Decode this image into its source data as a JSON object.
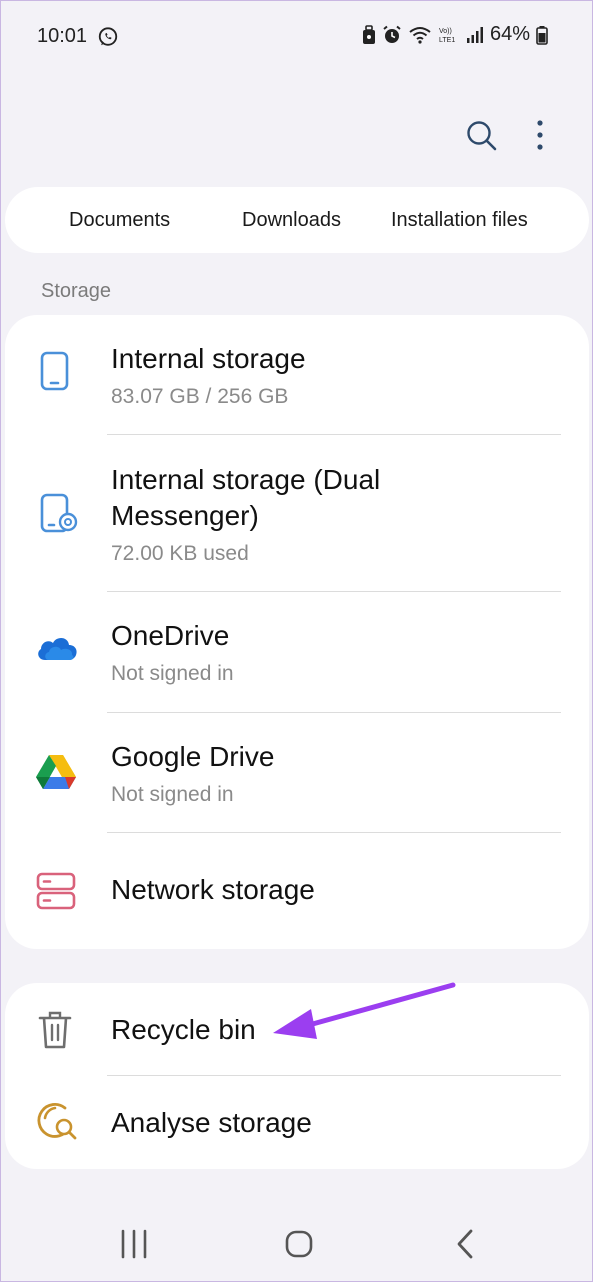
{
  "status_bar": {
    "time": "10:01",
    "battery": "64%"
  },
  "toolbar": {
    "search_icon": "search-icon",
    "more_icon": "more-vertical-icon"
  },
  "shortcuts": [
    {
      "label": "Documents"
    },
    {
      "label": "Downloads"
    },
    {
      "label": "Installation files"
    }
  ],
  "storage_section": {
    "label": "Storage",
    "items": [
      {
        "title": "Internal storage",
        "subtitle": "83.07 GB / 256 GB",
        "icon": "phone-icon"
      },
      {
        "title_line1": "Internal storage (Dual",
        "title_line2": "Messenger)",
        "subtitle": "72.00 KB used",
        "icon": "dual-messenger-phone-icon"
      },
      {
        "title": "OneDrive",
        "subtitle": "Not signed in",
        "icon": "onedrive-icon"
      },
      {
        "title": "Google Drive",
        "subtitle": "Not signed in",
        "icon": "google-drive-icon"
      },
      {
        "title": "Network storage",
        "icon": "network-storage-icon"
      }
    ]
  },
  "tools": {
    "items": [
      {
        "title": "Recycle bin",
        "icon": "trash-icon"
      },
      {
        "title": "Analyse storage",
        "icon": "analyse-storage-icon"
      }
    ]
  },
  "colors": {
    "background": "#f3f2f7",
    "card": "#ffffff",
    "accent_blue": "#4a90d9",
    "network_pink": "#d9627b",
    "analyse_gold": "#c9932e",
    "annotation_arrow": "#9b3ef0"
  }
}
